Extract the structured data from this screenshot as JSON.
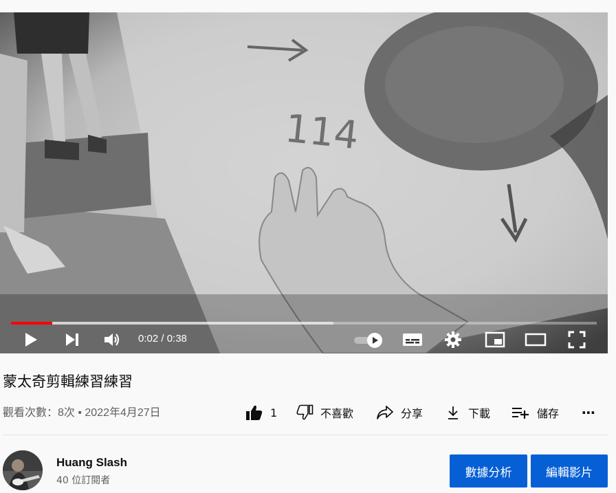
{
  "player": {
    "played_fraction": 0.07,
    "loaded_fraction": 0.55,
    "time_display": "0:02 / 0:38",
    "icons": [
      "play-icon",
      "next-icon",
      "volume-icon",
      "autoplay-toggle-icon",
      "subtitles-icon",
      "settings-icon",
      "miniplayer-icon",
      "theater-icon",
      "fullscreen-icon"
    ]
  },
  "video": {
    "title": "蒙太奇剪輯練習練習",
    "meta": "觀看次數：8次 • 2022年4月27日"
  },
  "actions": {
    "like_count": "1",
    "dislike_label": "不喜歡",
    "share_label": "分享",
    "download_label": "下載",
    "save_label": "儲存",
    "more_label": "⋯"
  },
  "channel": {
    "name": "Huang Slash",
    "subscribers": "40 位訂閱者"
  },
  "buttons": {
    "analytics_label": "數據分析",
    "edit_label": "編輯影片"
  },
  "colors": {
    "progress_played": "#ff0000",
    "primary_button": "#065fd4"
  }
}
